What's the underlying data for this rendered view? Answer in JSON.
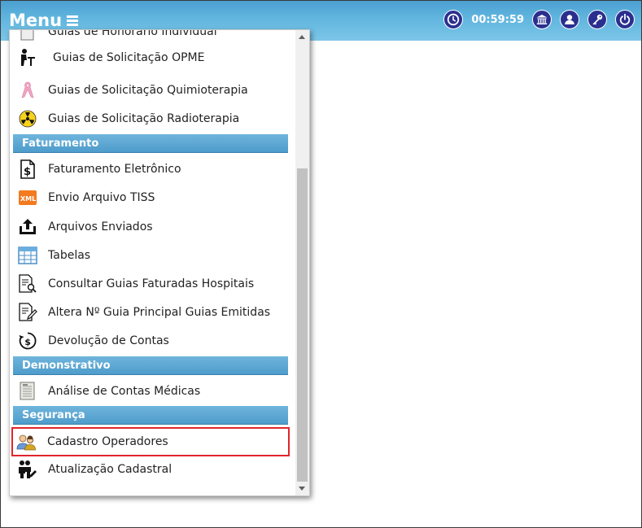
{
  "header": {
    "menu_label": "Menu",
    "timer": "00:59:59",
    "icons": [
      "clock-icon",
      "bank-icon",
      "user-icon",
      "key-icon",
      "power-icon"
    ]
  },
  "menu": {
    "partial_top": "Guias de Honorário Individual",
    "items_top": [
      {
        "label": "Guias de Solicitação OPME",
        "icon": "person-desk-icon"
      },
      {
        "label": "Guias de Solicitação Quimioterapia",
        "icon": "pink-ribbon-icon"
      },
      {
        "label": "Guias de Solicitação Radioterapia",
        "icon": "radiation-icon"
      }
    ],
    "sections": {
      "faturamento": "Faturamento",
      "demonstrativo": "Demonstrativo",
      "seguranca": "Segurança"
    },
    "faturamento_items": [
      {
        "label": "Faturamento Eletrônico",
        "icon": "dollar-document-icon"
      },
      {
        "label": "Envio Arquivo TISS",
        "icon": "xml-icon"
      },
      {
        "label": "Arquivos Enviados",
        "icon": "upload-box-icon"
      },
      {
        "label": "Tabelas",
        "icon": "table-icon"
      },
      {
        "label": "Consultar Guias Faturadas Hospitais",
        "icon": "document-search-icon"
      },
      {
        "label": "Altera Nº Guia Principal Guias Emitidas",
        "icon": "document-edit-icon"
      },
      {
        "label": "Devolução de Contas",
        "icon": "money-return-icon"
      }
    ],
    "demonstrativo_items": [
      {
        "label": "Análise de Contas Médicas",
        "icon": "ledger-icon"
      }
    ],
    "seguranca_items": [
      {
        "label": "Cadastro Operadores",
        "icon": "operators-icon"
      },
      {
        "label": "Atualização Cadastral",
        "icon": "people-edit-icon"
      }
    ]
  },
  "colors": {
    "header_top": "#4a9fd0",
    "section_bg": "#5aa8d4",
    "icon_circle": "#2a2f8f",
    "highlight": "#e0262c"
  }
}
